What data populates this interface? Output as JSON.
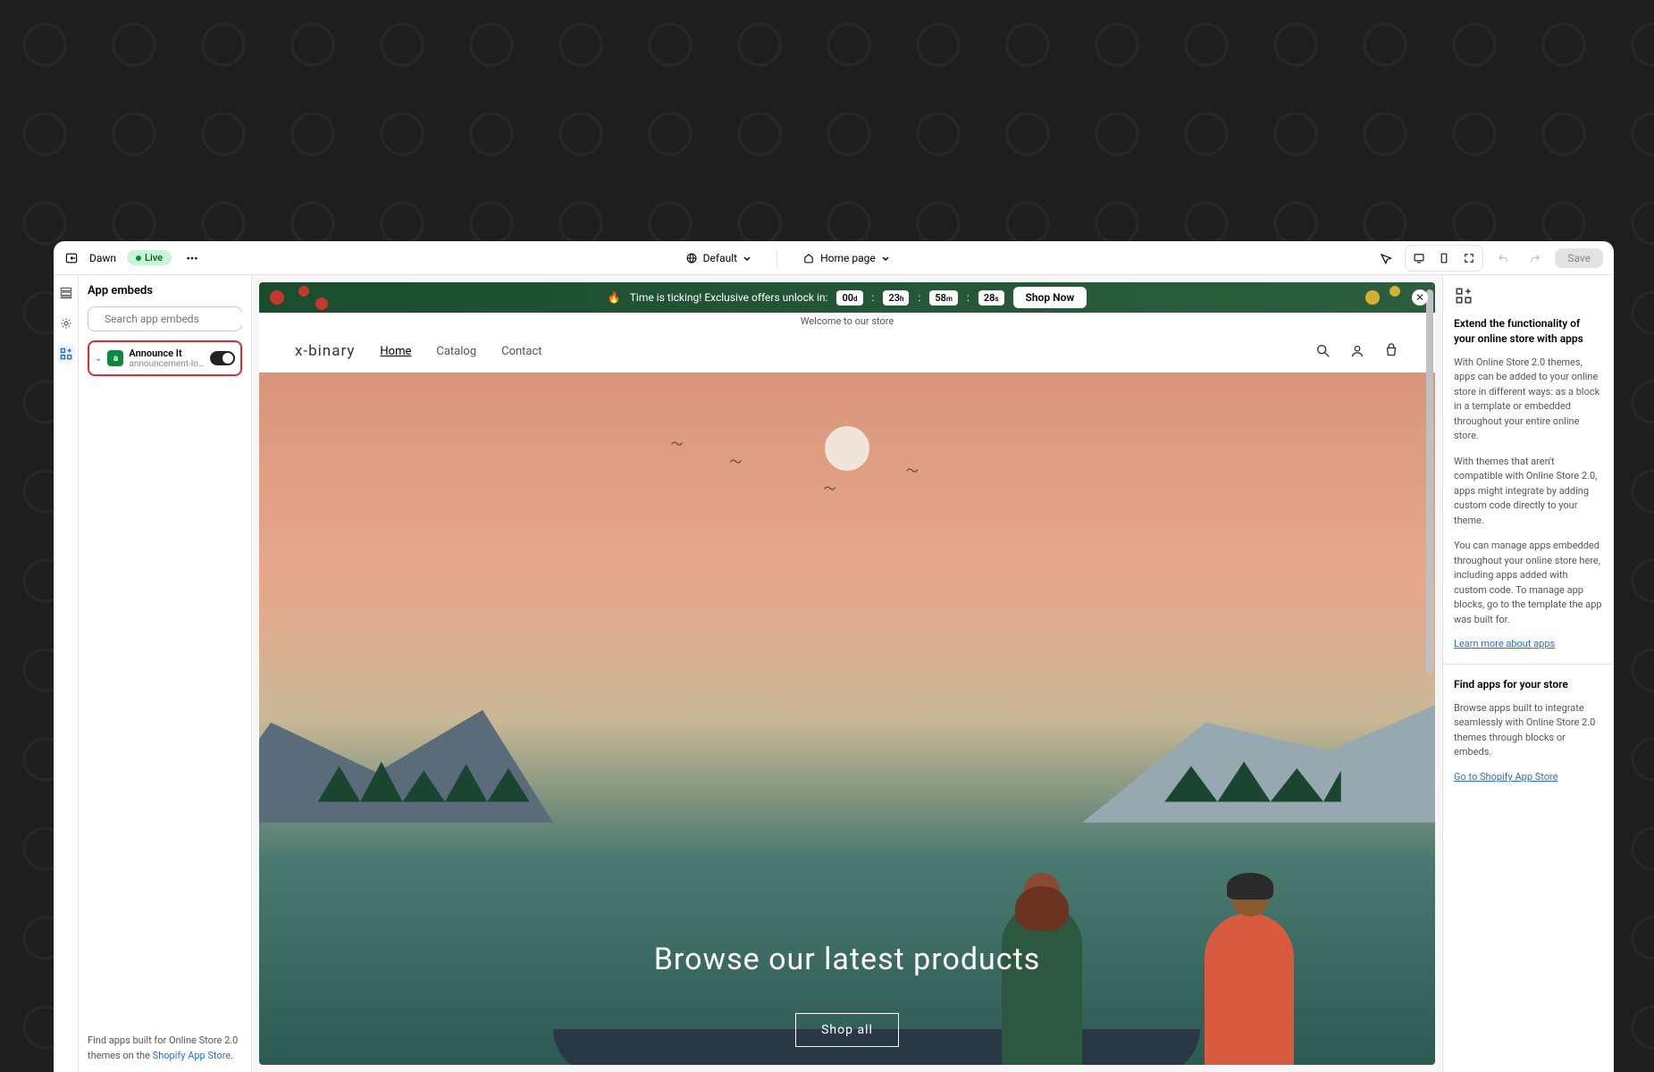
{
  "topbar": {
    "theme_name": "Dawn",
    "live_label": "Live",
    "template_label": "Default",
    "page_label": "Home page",
    "save_label": "Save"
  },
  "sidebar": {
    "title": "App embeds",
    "search_placeholder": "Search app embeds",
    "embed": {
      "name": "Announce It",
      "subtitle": "announcement-local-so...",
      "enabled": true
    },
    "footer_text": "Find apps built for Online Store 2.0 themes on the ",
    "footer_link": "Shopify App Store"
  },
  "preview": {
    "announcement": {
      "prefix": "🔥",
      "text": "Time is ticking! Exclusive offers unlock in:",
      "timer": {
        "d": "00",
        "h": "23",
        "m": "58",
        "s": "28"
      },
      "cta": "Shop Now"
    },
    "welcome": "Welcome to our store",
    "store_name": "x-binary",
    "nav": [
      "Home",
      "Catalog",
      "Contact"
    ],
    "hero_title": "Browse our latest products",
    "hero_cta": "Shop all"
  },
  "rightpanel": {
    "title": "Extend the functionality of your online store with apps",
    "p1": "With Online Store 2.0 themes, apps can be added to your online store in different ways: as a block in a template or embedded throughout your entire online store.",
    "p2": "With themes that aren't compatible with Online Store 2.0, apps might integrate by adding custom code directly to your theme.",
    "p3": "You can manage apps embedded throughout your online store here, including apps added with custom code. To manage app blocks, go to the template the app was built for.",
    "link1": "Learn more about apps",
    "section2_title": "Find apps for your store",
    "p4": "Browse apps built to integrate seamlessly with Online Store 2.0 themes through blocks or embeds.",
    "link2": "Go to Shopify App Store"
  }
}
